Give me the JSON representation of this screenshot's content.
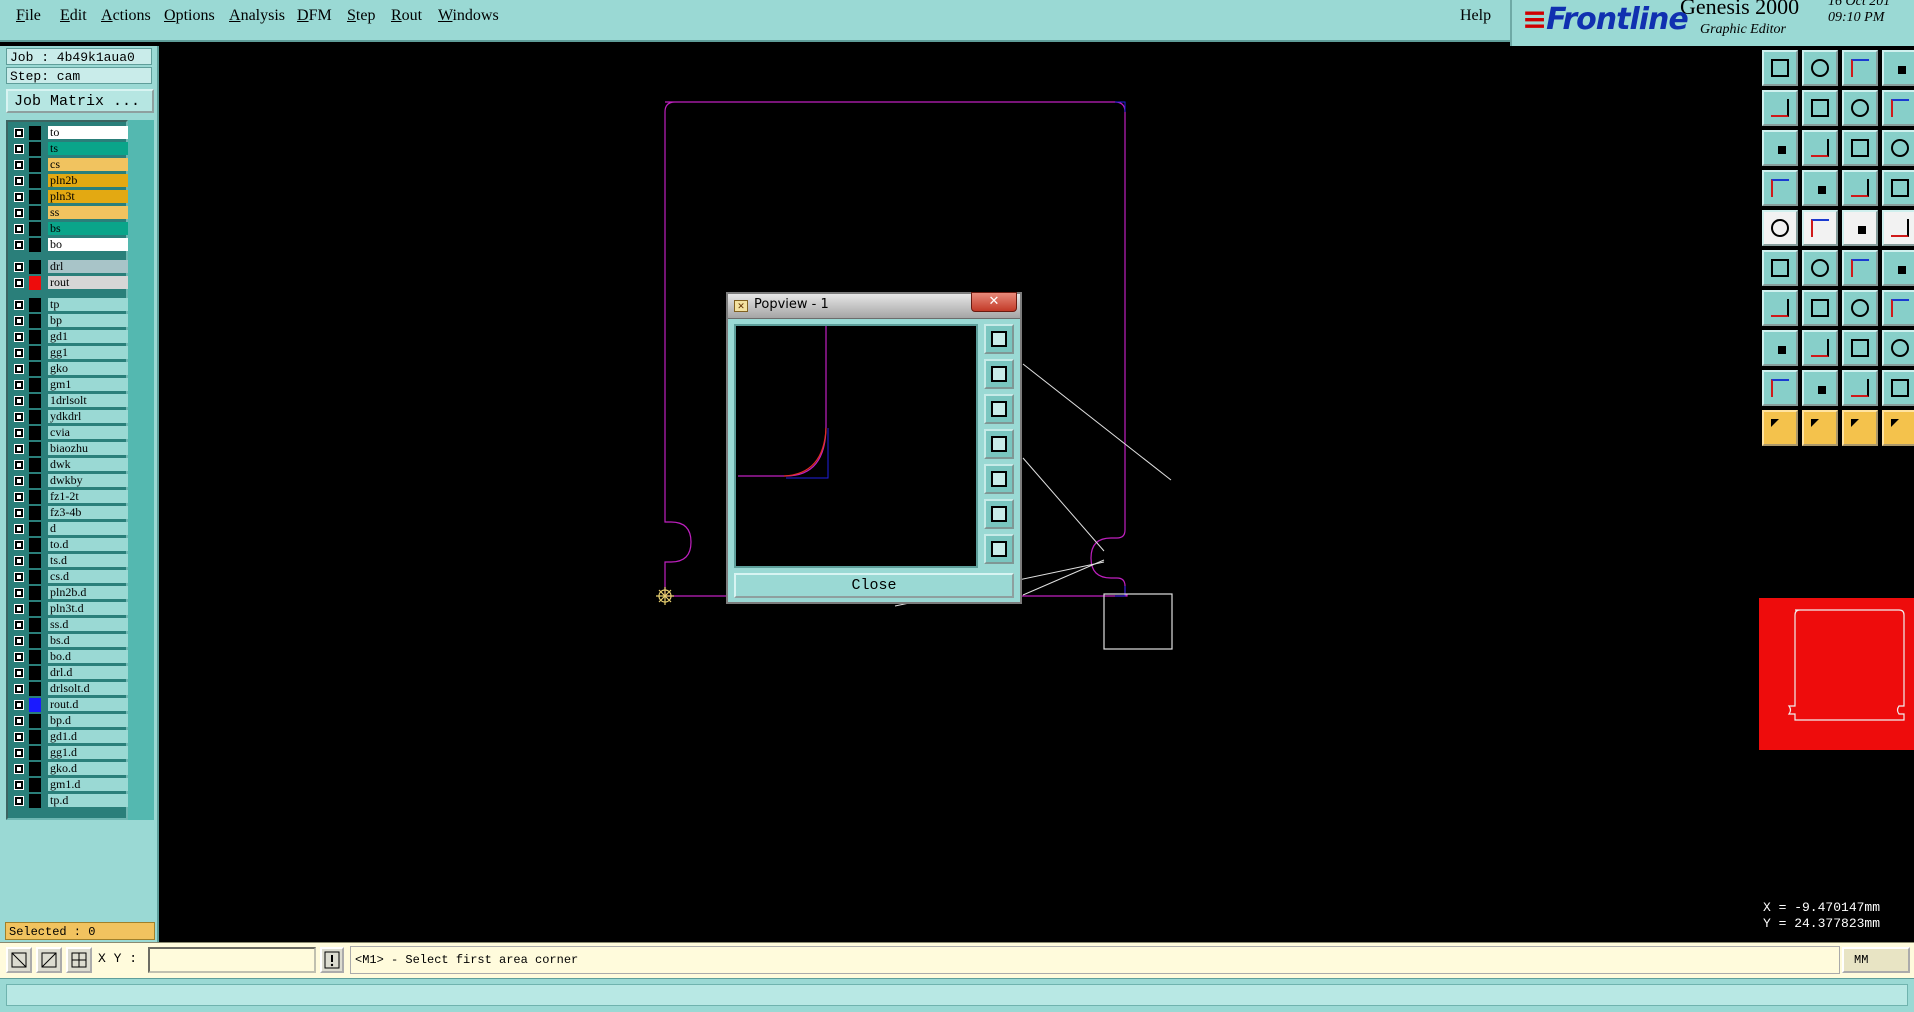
{
  "menubar": {
    "items": [
      {
        "label": "File",
        "mn": "F"
      },
      {
        "label": "Edit",
        "mn": "E"
      },
      {
        "label": "Actions",
        "mn": "A"
      },
      {
        "label": "Options",
        "mn": "O"
      },
      {
        "label": "Analysis",
        "mn": "A"
      },
      {
        "label": "DFM",
        "mn": "D"
      },
      {
        "label": "Step",
        "mn": "S"
      },
      {
        "label": "Rout",
        "mn": "R"
      },
      {
        "label": "Windows",
        "mn": "W"
      }
    ],
    "help": "Help"
  },
  "brand": {
    "logo": "Frontline",
    "product": "Genesis 2000",
    "subtitle": "Graphic Editor",
    "date": "16 Oct 201",
    "time": "09:10 PM"
  },
  "job": {
    "job_line": "Job : 4b49k1aua0",
    "step_line": "Step: cam",
    "job_matrix_button": "Job Matrix ..."
  },
  "layers": [
    {
      "name": "to",
      "color": "#ffffff"
    },
    {
      "name": "ts",
      "color": "#0aa58a"
    },
    {
      "name": "cs",
      "color": "#f1c35f"
    },
    {
      "name": "pln2b",
      "color": "#e3a912"
    },
    {
      "name": "pln3t",
      "color": "#e3a912"
    },
    {
      "name": "ss",
      "color": "#f1c35f"
    },
    {
      "name": "bs",
      "color": "#0aa58a"
    },
    {
      "name": "bo",
      "color": "#ffffff"
    },
    {
      "name": "drl",
      "color": "#a8c4c8"
    },
    {
      "name": "rout",
      "color": "#d6d6d6",
      "swatch": "#ee0c0c",
      "active": true
    },
    {
      "name": "tp",
      "color": "#9ad9d4"
    },
    {
      "name": "bp",
      "color": "#9ad9d4"
    },
    {
      "name": "gd1",
      "color": "#9ad9d4"
    },
    {
      "name": "gg1",
      "color": "#9ad9d4"
    },
    {
      "name": "gko",
      "color": "#9ad9d4"
    },
    {
      "name": "gm1",
      "color": "#9ad9d4"
    },
    {
      "name": "1drlsolt",
      "color": "#9ad9d4"
    },
    {
      "name": "ydkdrl",
      "color": "#9ad9d4"
    },
    {
      "name": "cvia",
      "color": "#9ad9d4"
    },
    {
      "name": "biaozhu",
      "color": "#9ad9d4"
    },
    {
      "name": "dwk",
      "color": "#9ad9d4"
    },
    {
      "name": "dwkby",
      "color": "#9ad9d4"
    },
    {
      "name": "fz1-2t",
      "color": "#9ad9d4"
    },
    {
      "name": "fz3-4b",
      "color": "#9ad9d4"
    },
    {
      "name": "d",
      "color": "#9ad9d4"
    },
    {
      "name": "to.d",
      "color": "#9ad9d4"
    },
    {
      "name": "ts.d",
      "color": "#9ad9d4"
    },
    {
      "name": "cs.d",
      "color": "#9ad9d4"
    },
    {
      "name": "pln2b.d",
      "color": "#9ad9d4"
    },
    {
      "name": "pln3t.d",
      "color": "#9ad9d4"
    },
    {
      "name": "ss.d",
      "color": "#9ad9d4"
    },
    {
      "name": "bs.d",
      "color": "#9ad9d4"
    },
    {
      "name": "bo.d",
      "color": "#9ad9d4"
    },
    {
      "name": "drl.d",
      "color": "#9ad9d4"
    },
    {
      "name": "drlsolt.d",
      "color": "#9ad9d4"
    },
    {
      "name": "rout.d",
      "color": "#9ad9d4",
      "swatch": "#1a1aff"
    },
    {
      "name": "bp.d",
      "color": "#9ad9d4"
    },
    {
      "name": "gd1.d",
      "color": "#9ad9d4"
    },
    {
      "name": "gg1.d",
      "color": "#9ad9d4"
    },
    {
      "name": "gko.d",
      "color": "#9ad9d4"
    },
    {
      "name": "gm1.d",
      "color": "#9ad9d4"
    },
    {
      "name": "tp.d",
      "color": "#9ad9d4"
    }
  ],
  "selected": "Selected : 0",
  "popview": {
    "title": "Popview - 1",
    "close_x": "✕",
    "close_button": "Close",
    "tools": [
      "zoom-window-icon",
      "layer-up-icon",
      "layer-down-icon",
      "pan-left-icon",
      "pan-right-icon",
      "zoom-home-icon",
      "fit-view-icon"
    ]
  },
  "right_tools": {
    "rows": [
      [
        "layer-up-icon",
        "layer-down-icon",
        "home-icon",
        "grid-icon"
      ],
      [
        "pan-left-icon",
        "pan-right-icon",
        "swap-icon",
        "snap-icon"
      ],
      [
        "fit-vertical-icon",
        "fit-all-icon",
        "scale-icon",
        "query-icon"
      ],
      [
        "measure-icon",
        "probe-icon",
        "net-icon",
        "net-select-icon"
      ],
      [
        "pad-icon",
        "surface-icon",
        "ruler-icon",
        "dot-icon"
      ],
      [
        "connect-icon",
        "cross-icon",
        "line-point-icon",
        "point-icon"
      ],
      [
        "angle-icon",
        "slope-icon",
        "arc-icon",
        "text-icon"
      ],
      [
        "move-point-icon",
        "line-icon",
        "stretch-icon",
        "copy-icon"
      ],
      [
        "triangle-icon",
        "triangle-a-icon",
        "arc-a-icon",
        "arc-b-icon"
      ],
      [
        "select-icon",
        "select-box-icon",
        "select-circle-icon",
        "select-path-icon"
      ]
    ]
  },
  "coords": {
    "x": "X = -9.470147mm",
    "y": "Y = 24.377823mm"
  },
  "bottombar": {
    "xy_label": "X Y :",
    "xy_value": "",
    "message": "<M1> - Select first area corner",
    "units": "MM"
  },
  "colors": {
    "panel": "#9ad9d4",
    "outline": "#c020c0",
    "overview": "#ee0c0c"
  }
}
